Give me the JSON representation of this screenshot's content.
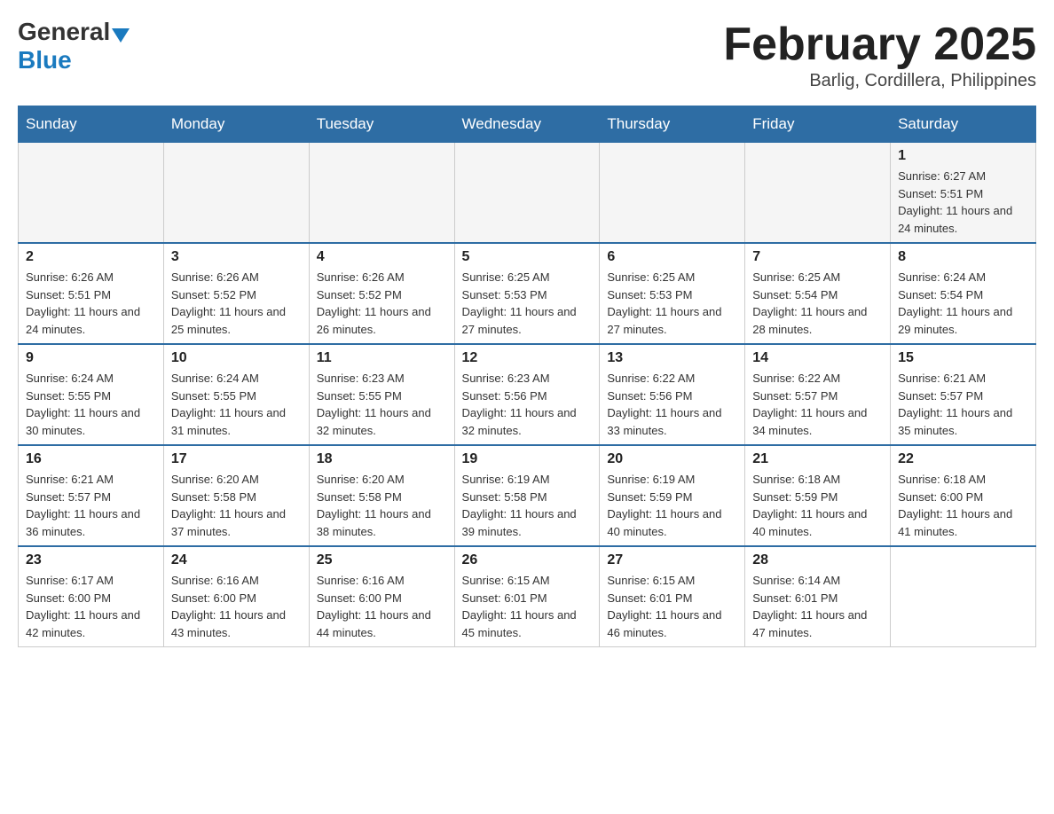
{
  "header": {
    "title": "February 2025",
    "subtitle": "Barlig, Cordillera, Philippines",
    "logo_general": "General",
    "logo_blue": "Blue"
  },
  "days_of_week": [
    "Sunday",
    "Monday",
    "Tuesday",
    "Wednesday",
    "Thursday",
    "Friday",
    "Saturday"
  ],
  "weeks": [
    {
      "days": [
        {
          "num": "",
          "sunrise": "",
          "sunset": "",
          "daylight": ""
        },
        {
          "num": "",
          "sunrise": "",
          "sunset": "",
          "daylight": ""
        },
        {
          "num": "",
          "sunrise": "",
          "sunset": "",
          "daylight": ""
        },
        {
          "num": "",
          "sunrise": "",
          "sunset": "",
          "daylight": ""
        },
        {
          "num": "",
          "sunrise": "",
          "sunset": "",
          "daylight": ""
        },
        {
          "num": "",
          "sunrise": "",
          "sunset": "",
          "daylight": ""
        },
        {
          "num": "1",
          "sunrise": "Sunrise: 6:27 AM",
          "sunset": "Sunset: 5:51 PM",
          "daylight": "Daylight: 11 hours and 24 minutes."
        }
      ]
    },
    {
      "days": [
        {
          "num": "2",
          "sunrise": "Sunrise: 6:26 AM",
          "sunset": "Sunset: 5:51 PM",
          "daylight": "Daylight: 11 hours and 24 minutes."
        },
        {
          "num": "3",
          "sunrise": "Sunrise: 6:26 AM",
          "sunset": "Sunset: 5:52 PM",
          "daylight": "Daylight: 11 hours and 25 minutes."
        },
        {
          "num": "4",
          "sunrise": "Sunrise: 6:26 AM",
          "sunset": "Sunset: 5:52 PM",
          "daylight": "Daylight: 11 hours and 26 minutes."
        },
        {
          "num": "5",
          "sunrise": "Sunrise: 6:25 AM",
          "sunset": "Sunset: 5:53 PM",
          "daylight": "Daylight: 11 hours and 27 minutes."
        },
        {
          "num": "6",
          "sunrise": "Sunrise: 6:25 AM",
          "sunset": "Sunset: 5:53 PM",
          "daylight": "Daylight: 11 hours and 27 minutes."
        },
        {
          "num": "7",
          "sunrise": "Sunrise: 6:25 AM",
          "sunset": "Sunset: 5:54 PM",
          "daylight": "Daylight: 11 hours and 28 minutes."
        },
        {
          "num": "8",
          "sunrise": "Sunrise: 6:24 AM",
          "sunset": "Sunset: 5:54 PM",
          "daylight": "Daylight: 11 hours and 29 minutes."
        }
      ]
    },
    {
      "days": [
        {
          "num": "9",
          "sunrise": "Sunrise: 6:24 AM",
          "sunset": "Sunset: 5:55 PM",
          "daylight": "Daylight: 11 hours and 30 minutes."
        },
        {
          "num": "10",
          "sunrise": "Sunrise: 6:24 AM",
          "sunset": "Sunset: 5:55 PM",
          "daylight": "Daylight: 11 hours and 31 minutes."
        },
        {
          "num": "11",
          "sunrise": "Sunrise: 6:23 AM",
          "sunset": "Sunset: 5:55 PM",
          "daylight": "Daylight: 11 hours and 32 minutes."
        },
        {
          "num": "12",
          "sunrise": "Sunrise: 6:23 AM",
          "sunset": "Sunset: 5:56 PM",
          "daylight": "Daylight: 11 hours and 32 minutes."
        },
        {
          "num": "13",
          "sunrise": "Sunrise: 6:22 AM",
          "sunset": "Sunset: 5:56 PM",
          "daylight": "Daylight: 11 hours and 33 minutes."
        },
        {
          "num": "14",
          "sunrise": "Sunrise: 6:22 AM",
          "sunset": "Sunset: 5:57 PM",
          "daylight": "Daylight: 11 hours and 34 minutes."
        },
        {
          "num": "15",
          "sunrise": "Sunrise: 6:21 AM",
          "sunset": "Sunset: 5:57 PM",
          "daylight": "Daylight: 11 hours and 35 minutes."
        }
      ]
    },
    {
      "days": [
        {
          "num": "16",
          "sunrise": "Sunrise: 6:21 AM",
          "sunset": "Sunset: 5:57 PM",
          "daylight": "Daylight: 11 hours and 36 minutes."
        },
        {
          "num": "17",
          "sunrise": "Sunrise: 6:20 AM",
          "sunset": "Sunset: 5:58 PM",
          "daylight": "Daylight: 11 hours and 37 minutes."
        },
        {
          "num": "18",
          "sunrise": "Sunrise: 6:20 AM",
          "sunset": "Sunset: 5:58 PM",
          "daylight": "Daylight: 11 hours and 38 minutes."
        },
        {
          "num": "19",
          "sunrise": "Sunrise: 6:19 AM",
          "sunset": "Sunset: 5:58 PM",
          "daylight": "Daylight: 11 hours and 39 minutes."
        },
        {
          "num": "20",
          "sunrise": "Sunrise: 6:19 AM",
          "sunset": "Sunset: 5:59 PM",
          "daylight": "Daylight: 11 hours and 40 minutes."
        },
        {
          "num": "21",
          "sunrise": "Sunrise: 6:18 AM",
          "sunset": "Sunset: 5:59 PM",
          "daylight": "Daylight: 11 hours and 40 minutes."
        },
        {
          "num": "22",
          "sunrise": "Sunrise: 6:18 AM",
          "sunset": "Sunset: 6:00 PM",
          "daylight": "Daylight: 11 hours and 41 minutes."
        }
      ]
    },
    {
      "days": [
        {
          "num": "23",
          "sunrise": "Sunrise: 6:17 AM",
          "sunset": "Sunset: 6:00 PM",
          "daylight": "Daylight: 11 hours and 42 minutes."
        },
        {
          "num": "24",
          "sunrise": "Sunrise: 6:16 AM",
          "sunset": "Sunset: 6:00 PM",
          "daylight": "Daylight: 11 hours and 43 minutes."
        },
        {
          "num": "25",
          "sunrise": "Sunrise: 6:16 AM",
          "sunset": "Sunset: 6:00 PM",
          "daylight": "Daylight: 11 hours and 44 minutes."
        },
        {
          "num": "26",
          "sunrise": "Sunrise: 6:15 AM",
          "sunset": "Sunset: 6:01 PM",
          "daylight": "Daylight: 11 hours and 45 minutes."
        },
        {
          "num": "27",
          "sunrise": "Sunrise: 6:15 AM",
          "sunset": "Sunset: 6:01 PM",
          "daylight": "Daylight: 11 hours and 46 minutes."
        },
        {
          "num": "28",
          "sunrise": "Sunrise: 6:14 AM",
          "sunset": "Sunset: 6:01 PM",
          "daylight": "Daylight: 11 hours and 47 minutes."
        },
        {
          "num": "",
          "sunrise": "",
          "sunset": "",
          "daylight": ""
        }
      ]
    }
  ]
}
